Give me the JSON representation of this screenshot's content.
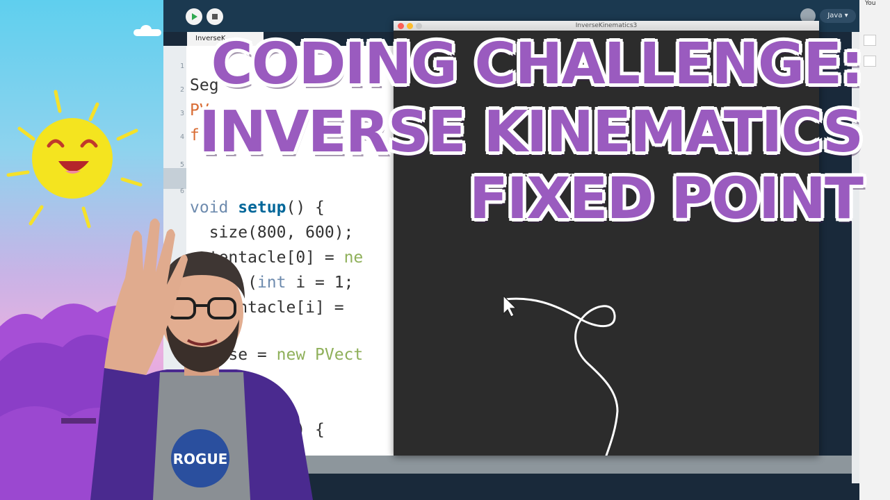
{
  "ide": {
    "tab_label": "InverseK",
    "mode_label": "Java ▾",
    "line_numbers": [
      "1",
      "2",
      "3",
      "4",
      "5",
      "6"
    ],
    "code_lines": [
      {
        "parts": [
          {
            "t": "Seg",
            "c": ""
          }
        ]
      },
      {
        "parts": [
          {
            "t": "PV",
            "c": "ty"
          }
        ]
      },
      {
        "parts": [
          {
            "t": "fl",
            "c": "ty"
          }
        ]
      },
      {
        "parts": [
          {
            "t": "void ",
            "c": "kw"
          },
          {
            "t": "setup",
            "c": "fn"
          },
          {
            "t": "() {",
            "c": ""
          }
        ]
      },
      {
        "parts": [
          {
            "t": "  size(800, 600);",
            "c": ""
          }
        ]
      },
      {
        "parts": [
          {
            "t": "  tentacle[0] = ",
            "c": ""
          },
          {
            "t": "ne",
            "c": "nw"
          }
        ]
      },
      {
        "parts": [
          {
            "t": "   or",
            "c": "kw"
          },
          {
            "t": " (",
            "c": ""
          },
          {
            "t": "int",
            "c": "kw"
          },
          {
            "t": " i = 1;",
            "c": ""
          }
        ]
      },
      {
        "parts": [
          {
            "t": "   tentacle[i] = ",
            "c": ""
          }
        ]
      },
      {
        "parts": [
          {
            "t": "  base = ",
            "c": ""
          },
          {
            "t": "new",
            "c": "nw"
          },
          {
            "t": " PVect",
            "c": "nw"
          }
        ]
      },
      {
        "parts": [
          {
            "t": "          () {",
            "c": ""
          }
        ]
      }
    ]
  },
  "sketch": {
    "title": "InverseKinematics3"
  },
  "app_chrome": {
    "user_label": "You"
  },
  "title_overlay": {
    "line1": "CODING CHALLENGE:",
    "line2": "INVERSE KINEMATICS",
    "line3": "FIXED POINT"
  },
  "presenter": {
    "shirt_text": "ROGUE"
  },
  "colors": {
    "title_purple": "#9a5bbf",
    "ide_toolbar": "#1b3950",
    "sketch_bg": "#2c2c2c"
  }
}
